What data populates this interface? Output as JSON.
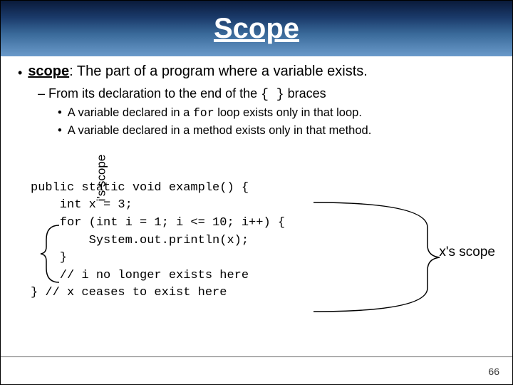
{
  "title": "Scope",
  "bullets": {
    "main": {
      "term": "scope",
      "rest": ": The part of a program where a variable exists."
    },
    "dash_prefix": "– From its declaration to the end of the ",
    "dash_braces": "{ }",
    "dash_suffix": " braces",
    "sub1_a": "A variable declared in a ",
    "sub1_code": "for",
    "sub1_b": " loop exists only in that loop.",
    "sub2": "A variable declared in a method exists only in that method."
  },
  "code": {
    "l1": "public static void example() {",
    "l2": "    int x = 3;",
    "l3": "    for (int i = 1; i <= 10; i++) {",
    "l4": "        System.out.println(x);",
    "l5": "    }",
    "l6": "    // i no longer exists here",
    "l7": "} // x ceases to exist here"
  },
  "labels": {
    "i_scope": "i's scope",
    "x_scope": "x's scope"
  },
  "page_number": "66"
}
